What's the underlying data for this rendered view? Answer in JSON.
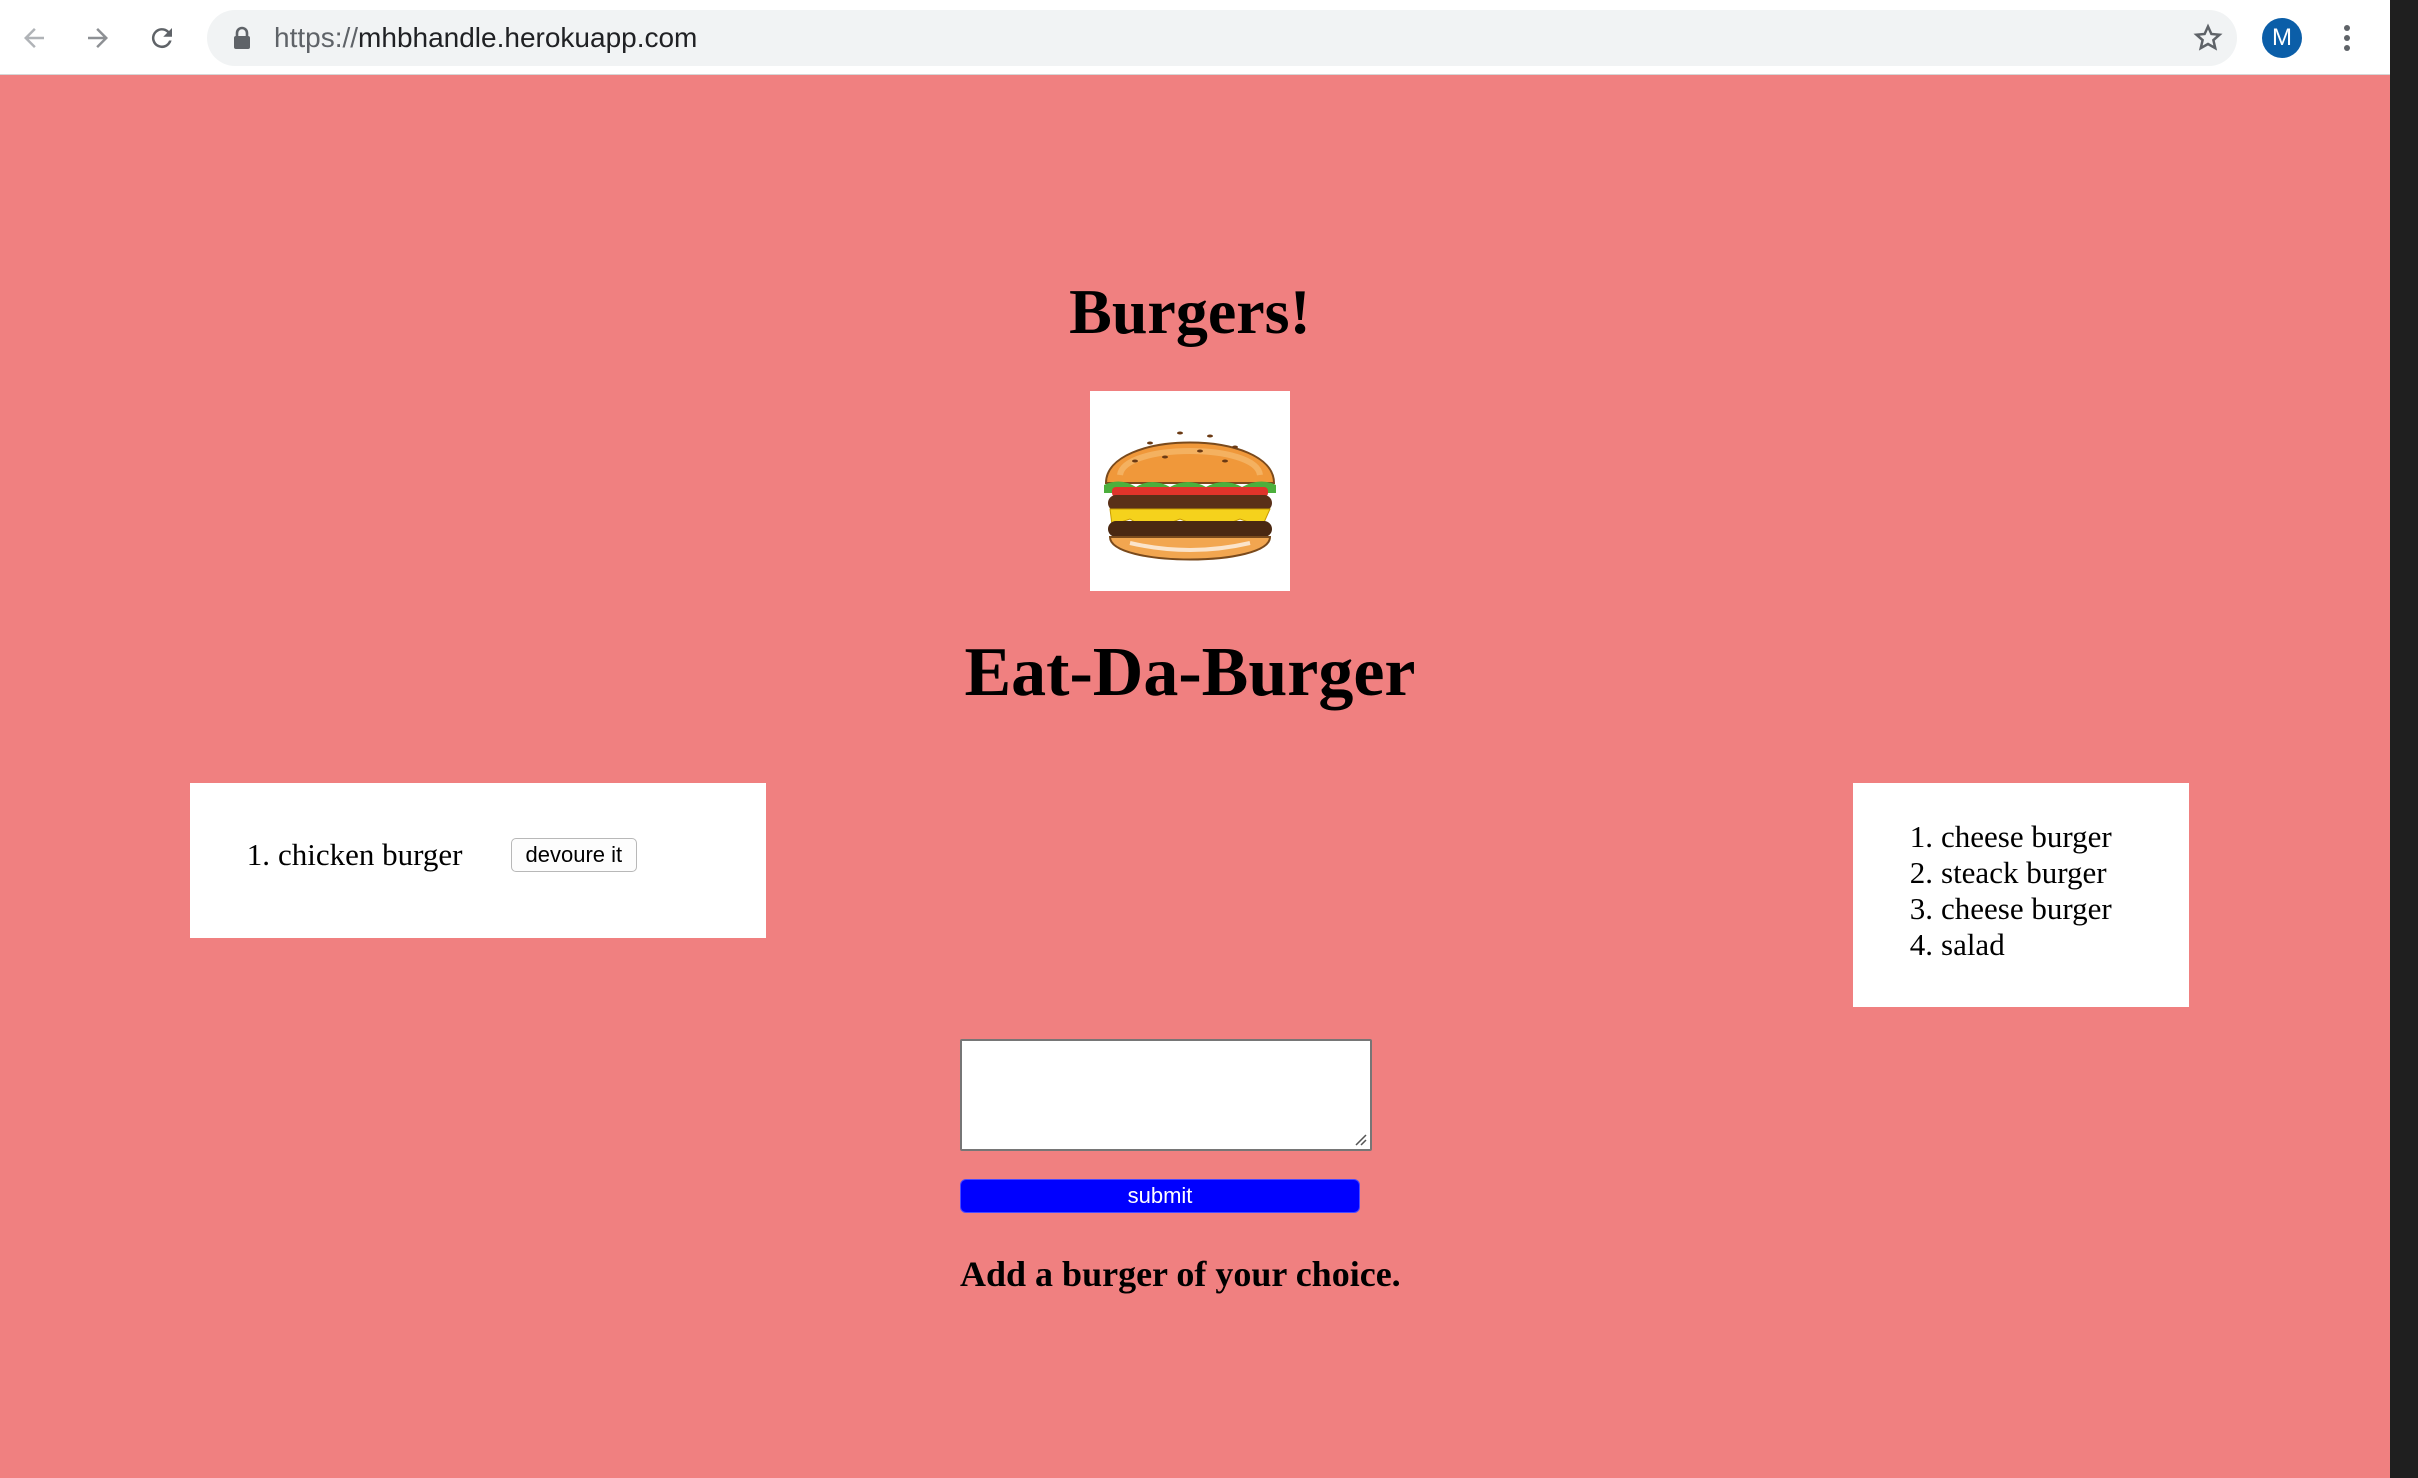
{
  "browser": {
    "url_scheme": "https://",
    "url_host": "mhbhandle.herokuapp.com",
    "profile_initial": "M",
    "icons": [
      "back-arrow-icon",
      "forward-arrow-icon",
      "reload-icon",
      "lock-icon",
      "star-icon",
      "menu-kebab-icon"
    ]
  },
  "page": {
    "title": "Burgers!",
    "subtitle": "Eat-Da-Burger",
    "background_color": "#f08080",
    "image": "burger-illustration"
  },
  "uneaten": {
    "items": [
      {
        "number": "1.",
        "name": "chicken burger",
        "button_label": "devoure it"
      }
    ]
  },
  "eaten": {
    "items": [
      {
        "number": "1.",
        "name": "cheese burger"
      },
      {
        "number": "2.",
        "name": "steack burger"
      },
      {
        "number": "3.",
        "name": "cheese burger"
      },
      {
        "number": "4.",
        "name": "salad"
      }
    ]
  },
  "form": {
    "input_value": "",
    "submit_label": "submit",
    "submit_color": "#0000ff",
    "hint": "Add a burger of your choice."
  }
}
